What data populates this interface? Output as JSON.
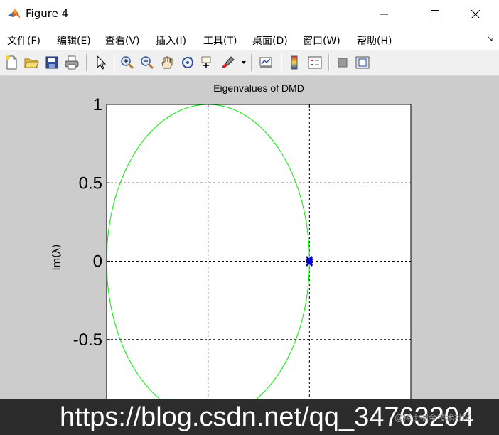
{
  "window": {
    "title": "Figure 4",
    "minimize_glyph": "—",
    "maximize_glyph": "☐",
    "close_glyph": "✕"
  },
  "menubar": {
    "items": [
      "文件(F)",
      "编辑(E)",
      "查看(V)",
      "插入(I)",
      "工具(T)",
      "桌面(D)",
      "窗口(W)",
      "帮助(H)"
    ],
    "overflow_glyph": "↘"
  },
  "toolbar": {
    "icons": [
      "new-figure-icon",
      "open-file-icon",
      "save-icon",
      "print-icon",
      "pointer-icon",
      "zoom-in-icon",
      "zoom-out-icon",
      "pan-hand-icon",
      "rotate-3d-icon",
      "data-cursor-icon",
      "brush-icon",
      "link-plot-icon",
      "colorbar-icon",
      "legend-icon",
      "hide-plot-tools-icon",
      "show-plot-tools-icon"
    ]
  },
  "chart_data": {
    "type": "scatter",
    "title": "Eigenvalues of DMD",
    "xlabel": "",
    "ylabel": "Im(λ)",
    "xlim": [
      -1.5,
      1.5
    ],
    "ylim": [
      -0.95,
      1
    ],
    "yticks": [
      "1",
      "0.5",
      "0",
      "-0.5"
    ],
    "yticks_values": [
      1,
      0.5,
      0,
      -0.5
    ],
    "xgrid_values": [
      -0.5,
      0.5
    ],
    "grid": true,
    "unit_circle_color": "#00ee00",
    "series": [
      {
        "marker": "x",
        "color": "#0000cc",
        "points": [
          [
            0.499,
            0.012
          ],
          [
            0.499,
            -0.012
          ],
          [
            0.501,
            0.006
          ],
          [
            0.501,
            -0.006
          ]
        ]
      }
    ]
  },
  "watermark": {
    "text": "https://blog.csdn.net/qq_34763204",
    "small_text": "@稀土掘金技术社区"
  }
}
